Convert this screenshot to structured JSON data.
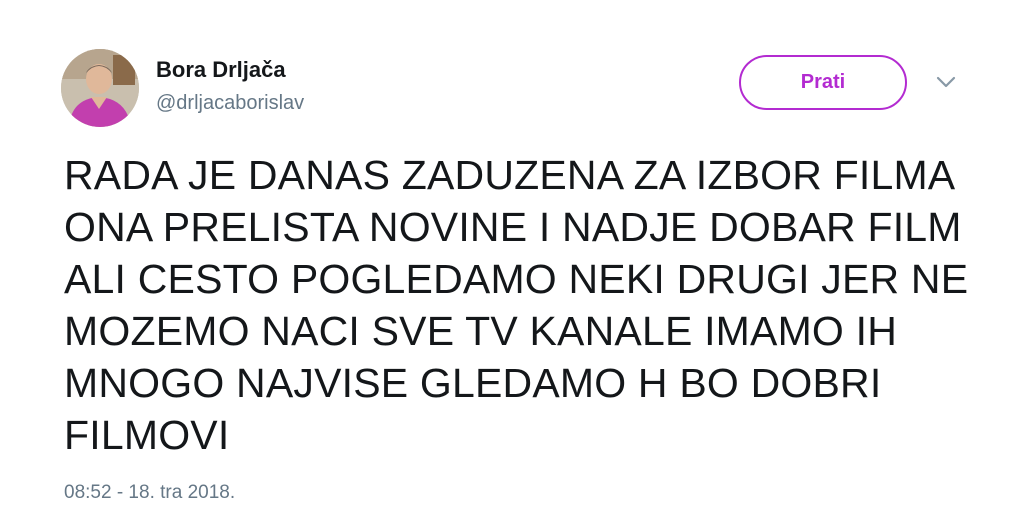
{
  "tweet": {
    "author": {
      "display_name": "Bora Drljača",
      "handle": "@drljacaborislav"
    },
    "follow_button_label": "Prati",
    "menu_icon": "chevron-down-icon",
    "text": "RADA JE DANAS ZADUZENA ZA IZBOR FILMA\nONA PRELISTA NOVINE I NADJE DOBAR FILM\nALI CESTO POGLEDAMO NEKI DRUGI JER NE\nMOZEMO NACI SVE TV KANALE IMAMO IH\nMNOGO NAJVISE GLEDAMO H BO DOBRI\nFILMOVI",
    "timestamp": "08:52 - 18. tra 2018."
  },
  "colors": {
    "accent": "#b32bd1",
    "text_primary": "#14171a",
    "text_secondary": "#657786"
  }
}
